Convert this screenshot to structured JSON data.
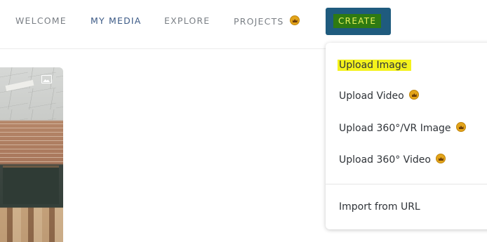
{
  "nav": {
    "welcome": "WELCOME",
    "my_media": "MY MEDIA",
    "explore": "EXPLORE",
    "projects": "PROJECTS",
    "create": "CREATE"
  },
  "icons": {
    "premium": "crown-icon",
    "image": "image-icon"
  },
  "colors": {
    "create_button_bg": "#1f5b7e",
    "create_label_highlight": "#2e7a12",
    "create_label_text": "#e8f25a",
    "active_nav": "#3c5a86",
    "premium_badge": "#e3a41a",
    "selection_highlight": "#f4f21c"
  },
  "create_menu": {
    "upload_image": "Upload Image",
    "upload_video": "Upload Video",
    "upload_360_vr_image": "Upload 360°/VR Image",
    "upload_360_video": "Upload 360° Video",
    "import_from_url": "Import from URL"
  }
}
